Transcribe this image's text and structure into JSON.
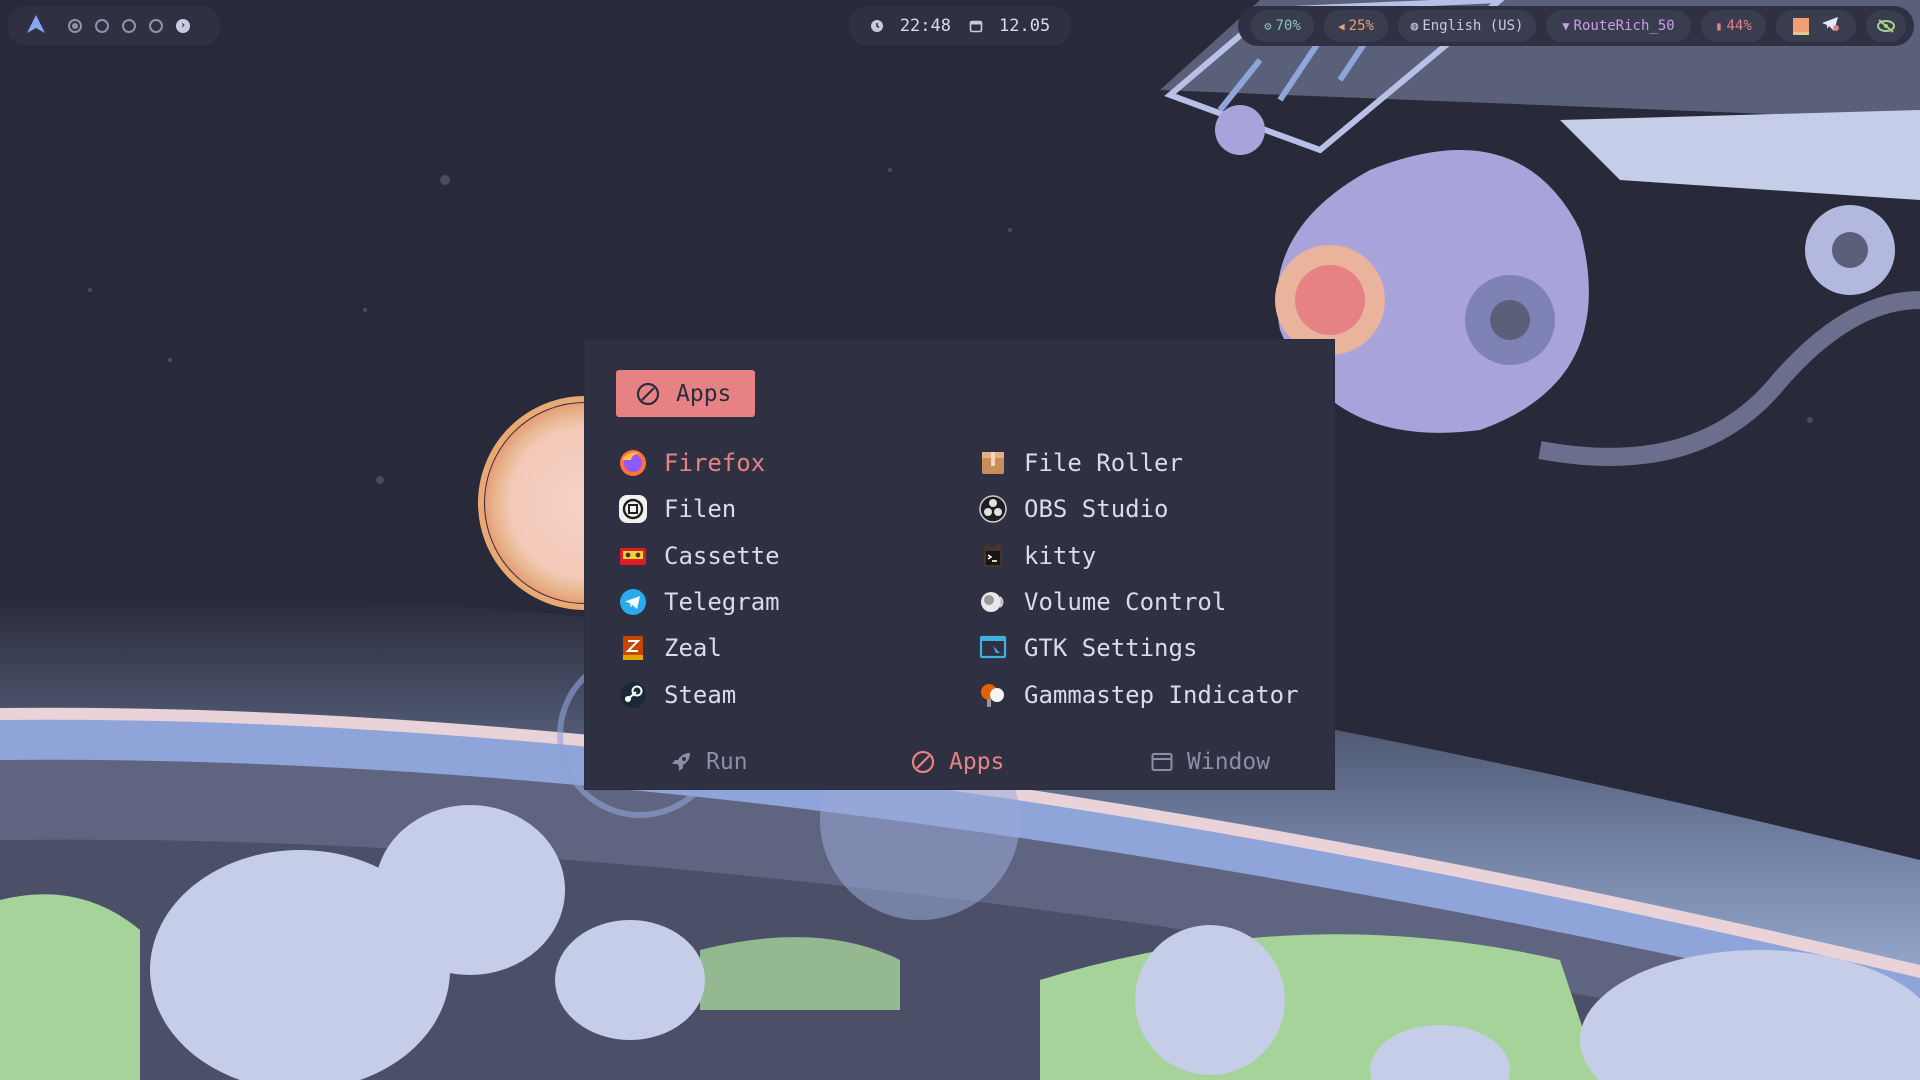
{
  "topbar": {
    "workspaces": [
      {
        "name": "workspace-1",
        "active": true
      },
      {
        "name": "workspace-2",
        "active": false
      },
      {
        "name": "workspace-3",
        "active": false
      },
      {
        "name": "workspace-4",
        "active": false
      }
    ],
    "time": "22:48",
    "date": "12.05",
    "tray": {
      "cpu": "70%",
      "volume": "25%",
      "keyboard_layout": "English (US)",
      "network": "RouteRich_50",
      "battery": "44%"
    }
  },
  "launcher": {
    "mode_label": "Apps",
    "apps_left": [
      {
        "name": "Firefox",
        "icon": "firefox-icon",
        "selected": true
      },
      {
        "name": "Filen",
        "icon": "filen-icon"
      },
      {
        "name": "Cassette",
        "icon": "cassette-icon"
      },
      {
        "name": "Telegram",
        "icon": "telegram-icon"
      },
      {
        "name": "Zeal",
        "icon": "zeal-icon"
      },
      {
        "name": "Steam",
        "icon": "steam-icon"
      }
    ],
    "apps_right": [
      {
        "name": "File Roller",
        "icon": "archive-icon"
      },
      {
        "name": "OBS Studio",
        "icon": "obs-icon"
      },
      {
        "name": "kitty",
        "icon": "kitty-icon"
      },
      {
        "name": "Volume Control",
        "icon": "volume-control-icon"
      },
      {
        "name": "GTK Settings",
        "icon": "gtk-settings-icon"
      },
      {
        "name": "Gammastep Indicator",
        "icon": "gammastep-icon"
      }
    ],
    "modes": {
      "run": "Run",
      "apps": "Apps",
      "window": "Window"
    }
  },
  "colors": {
    "accent": "#e78284",
    "panel": "#2f3142",
    "text": "#d8dbe9",
    "muted": "#8a8ea6"
  }
}
